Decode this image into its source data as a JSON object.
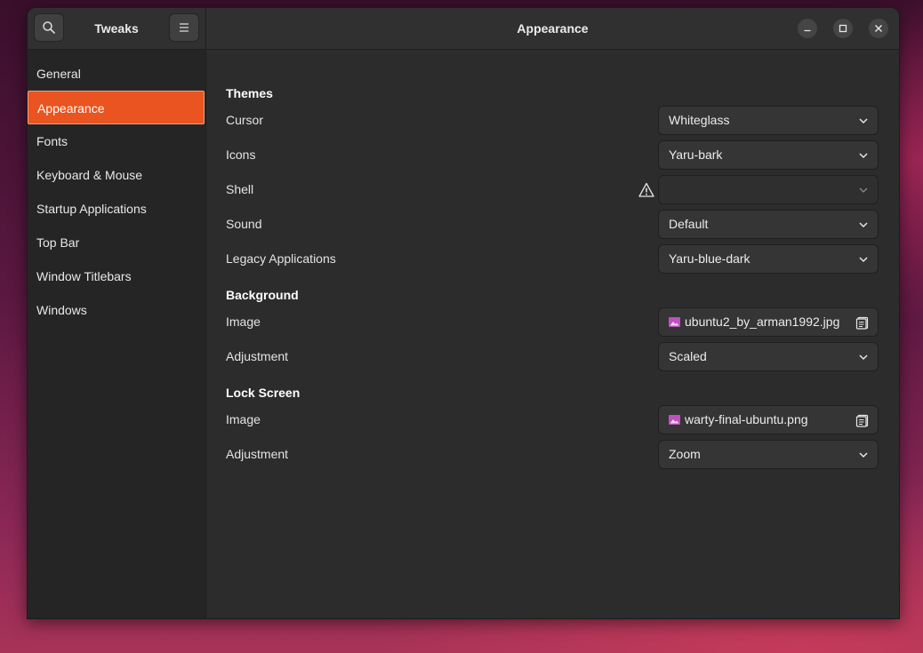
{
  "sidebar": {
    "title": "Tweaks",
    "items": [
      {
        "label": "General"
      },
      {
        "label": "Appearance"
      },
      {
        "label": "Fonts"
      },
      {
        "label": "Keyboard & Mouse"
      },
      {
        "label": "Startup Applications"
      },
      {
        "label": "Top Bar"
      },
      {
        "label": "Window Titlebars"
      },
      {
        "label": "Windows"
      }
    ],
    "active_index": 1
  },
  "header": {
    "title": "Appearance",
    "search_icon": "search-icon",
    "menu_icon": "hamburger-menu-icon",
    "window_controls": [
      "minimize-icon",
      "maximize-icon",
      "close-icon"
    ]
  },
  "themes": {
    "heading": "Themes",
    "cursor": {
      "label": "Cursor",
      "value": "Whiteglass"
    },
    "icons": {
      "label": "Icons",
      "value": "Yaru-bark"
    },
    "shell": {
      "label": "Shell",
      "value": "",
      "warning_icon": "warning-icon"
    },
    "sound": {
      "label": "Sound",
      "value": "Default"
    },
    "legacy": {
      "label": "Legacy Applications",
      "value": "Yaru-blue-dark"
    }
  },
  "background": {
    "heading": "Background",
    "image": {
      "label": "Image",
      "value": "ubuntu2_by_arman1992.jpg"
    },
    "adjustment": {
      "label": "Adjustment",
      "value": "Scaled"
    }
  },
  "lock_screen": {
    "heading": "Lock Screen",
    "image": {
      "label": "Image",
      "value": "warty-final-ubuntu.png"
    },
    "adjustment": {
      "label": "Adjustment",
      "value": "Zoom"
    }
  },
  "colors": {
    "accent": "#e95420",
    "file_icon": "#c04fc0"
  }
}
